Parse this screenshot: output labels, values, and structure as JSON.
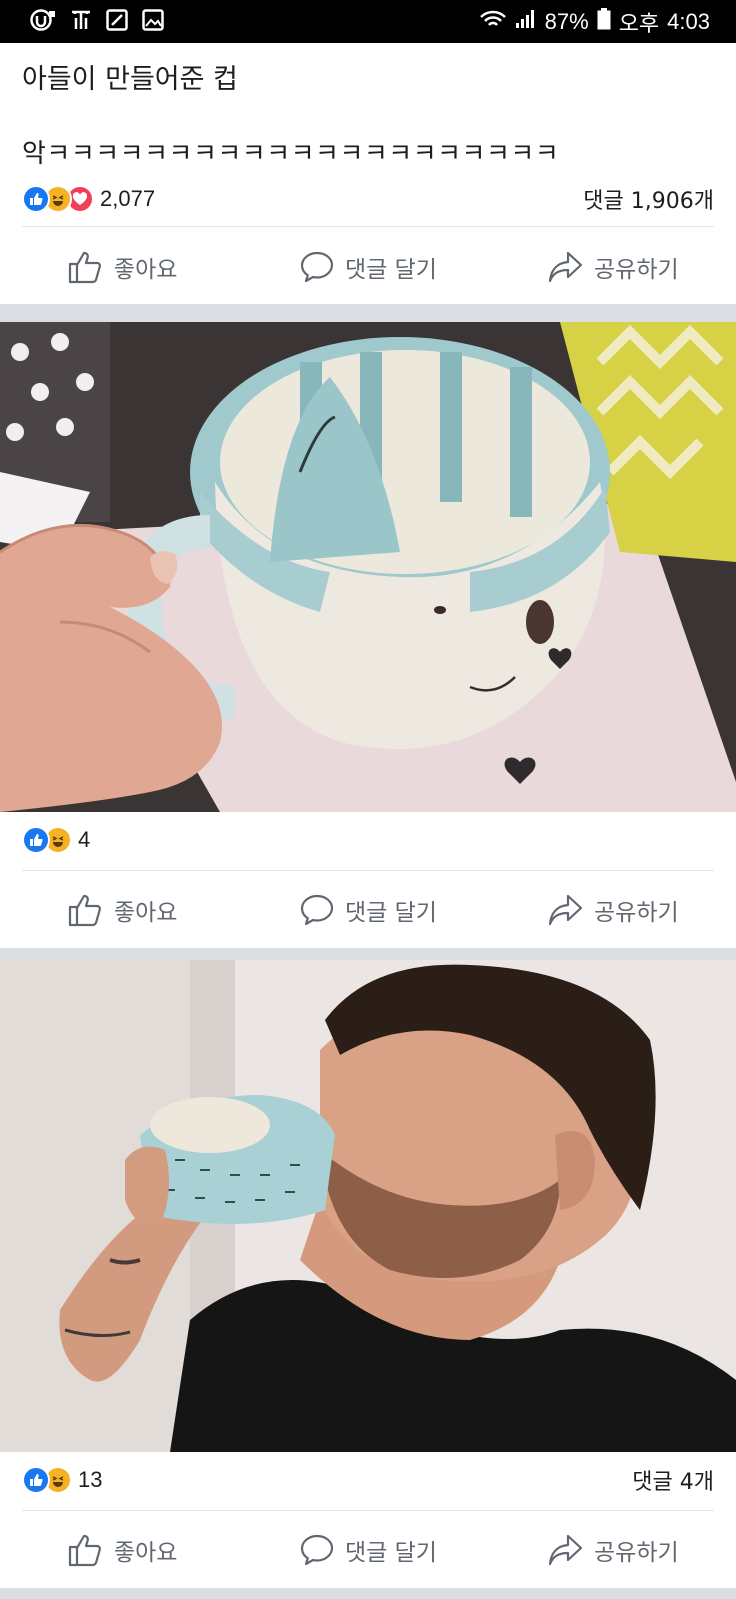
{
  "status_bar": {
    "battery": "87%",
    "period": "오후",
    "time": "4:03"
  },
  "post": {
    "title": "아들이 만들어준 컵",
    "text": "악ㅋㅋㅋㅋㅋㅋㅋㅋㅋㅋㅋㅋㅋㅋㅋㅋㅋㅋㅋㅋㅋ",
    "reaction_count": "2,077",
    "comment_count": "댓글 1,906개"
  },
  "actions": {
    "like": "좋아요",
    "comment": "댓글 달기",
    "share": "공유하기"
  },
  "photo1": {
    "reaction_count": "4"
  },
  "photo2": {
    "reaction_count": "13",
    "comment_count": "댓글 4개"
  },
  "colors": {
    "like_blue": "#1877f2",
    "haha_yellow": "#f7b125",
    "love_red": "#f33e58",
    "action_gray": "#606770",
    "feed_bg": "#dadde1"
  }
}
